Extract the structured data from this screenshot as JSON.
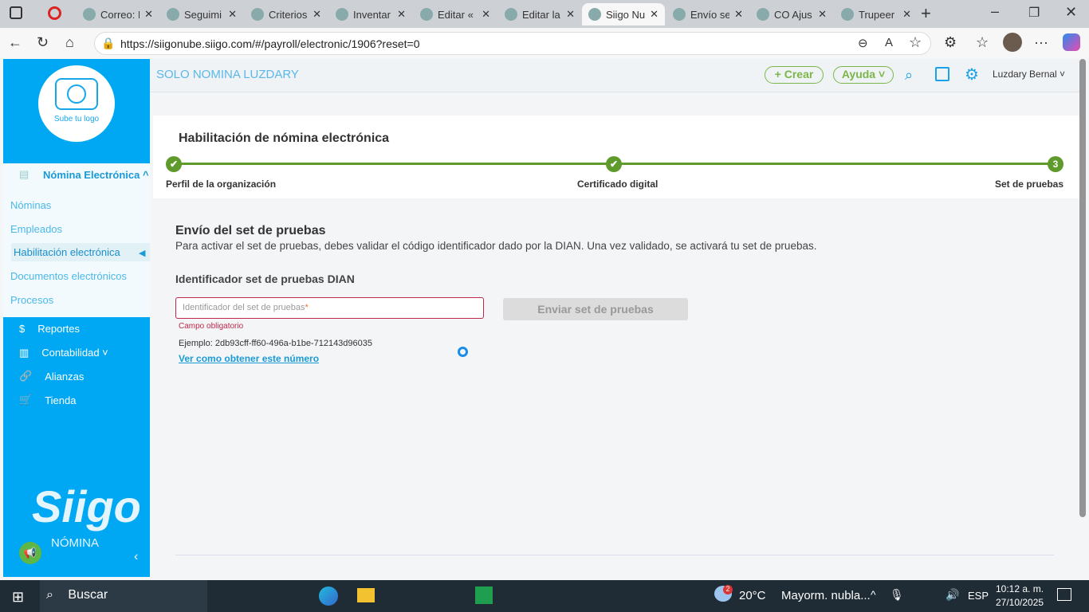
{
  "browser": {
    "tabs": [
      {
        "label": "Correo: L"
      },
      {
        "label": "Seguimi"
      },
      {
        "label": "Criterios"
      },
      {
        "label": "Inventar"
      },
      {
        "label": "Editar «"
      },
      {
        "label": "Editar la"
      },
      {
        "label": "Siigo Nu"
      },
      {
        "label": "Envío se"
      },
      {
        "label": "CO Ajus"
      },
      {
        "label": "Trupeer"
      }
    ],
    "active_tab": 6,
    "url": "https://siigonube.siigo.com/#/payroll/electronic/1906?reset=0"
  },
  "sidebar": {
    "logo_label": "Sube tu logo",
    "section": "Nómina Electrónica ^",
    "subitems": [
      "Nóminas",
      "Empleados",
      "Habilitación electrónica",
      "Documentos electrónicos",
      "Procesos"
    ],
    "active_sub": 2,
    "items": [
      "Reportes",
      "Contabilidad ˅",
      "Alianzas",
      "Tienda"
    ],
    "brand": "Siigo",
    "brand_sub": "NÓMINA"
  },
  "header": {
    "company": "SOLO NOMINA LUZDARY",
    "create": "+ Crear",
    "help": "Ayuda ˅",
    "user": "Luzdary Bernal ˅"
  },
  "wizard": {
    "title": "Habilitación de nómina electrónica",
    "steps": [
      {
        "label": "Perfil de la organización",
        "mark": "✔"
      },
      {
        "label": "Certificado digital",
        "mark": "✔"
      },
      {
        "label": "Set de pruebas",
        "mark": "3"
      }
    ]
  },
  "form": {
    "title": "Envío del set de pruebas",
    "description": "Para activar el set de pruebas, debes validar el código identificador dado por la DIAN. Una vez validado, se activará tu set de pruebas.",
    "field_label": "Identificador set de pruebas DIAN",
    "placeholder": "Identificador del set de pruebas",
    "required_mark": "*",
    "error": "Campo obligatorio",
    "example": "Ejemplo: 2db93cff-ff60-496a-b1be-712143d96035",
    "help_link": "Ver como obtener este número",
    "submit": "Enviar set de pruebas"
  },
  "taskbar": {
    "search": "Buscar",
    "weather": "20°C",
    "weather_text": "Mayorm. nubla...",
    "weather_badge": "2",
    "lang": "ESP",
    "time": "10:12 a. m.",
    "date": "27/10/2025"
  },
  "colors": {
    "sidebar": "#00a8f3",
    "accent_green": "#5e9a2c",
    "error": "#c0284a"
  }
}
